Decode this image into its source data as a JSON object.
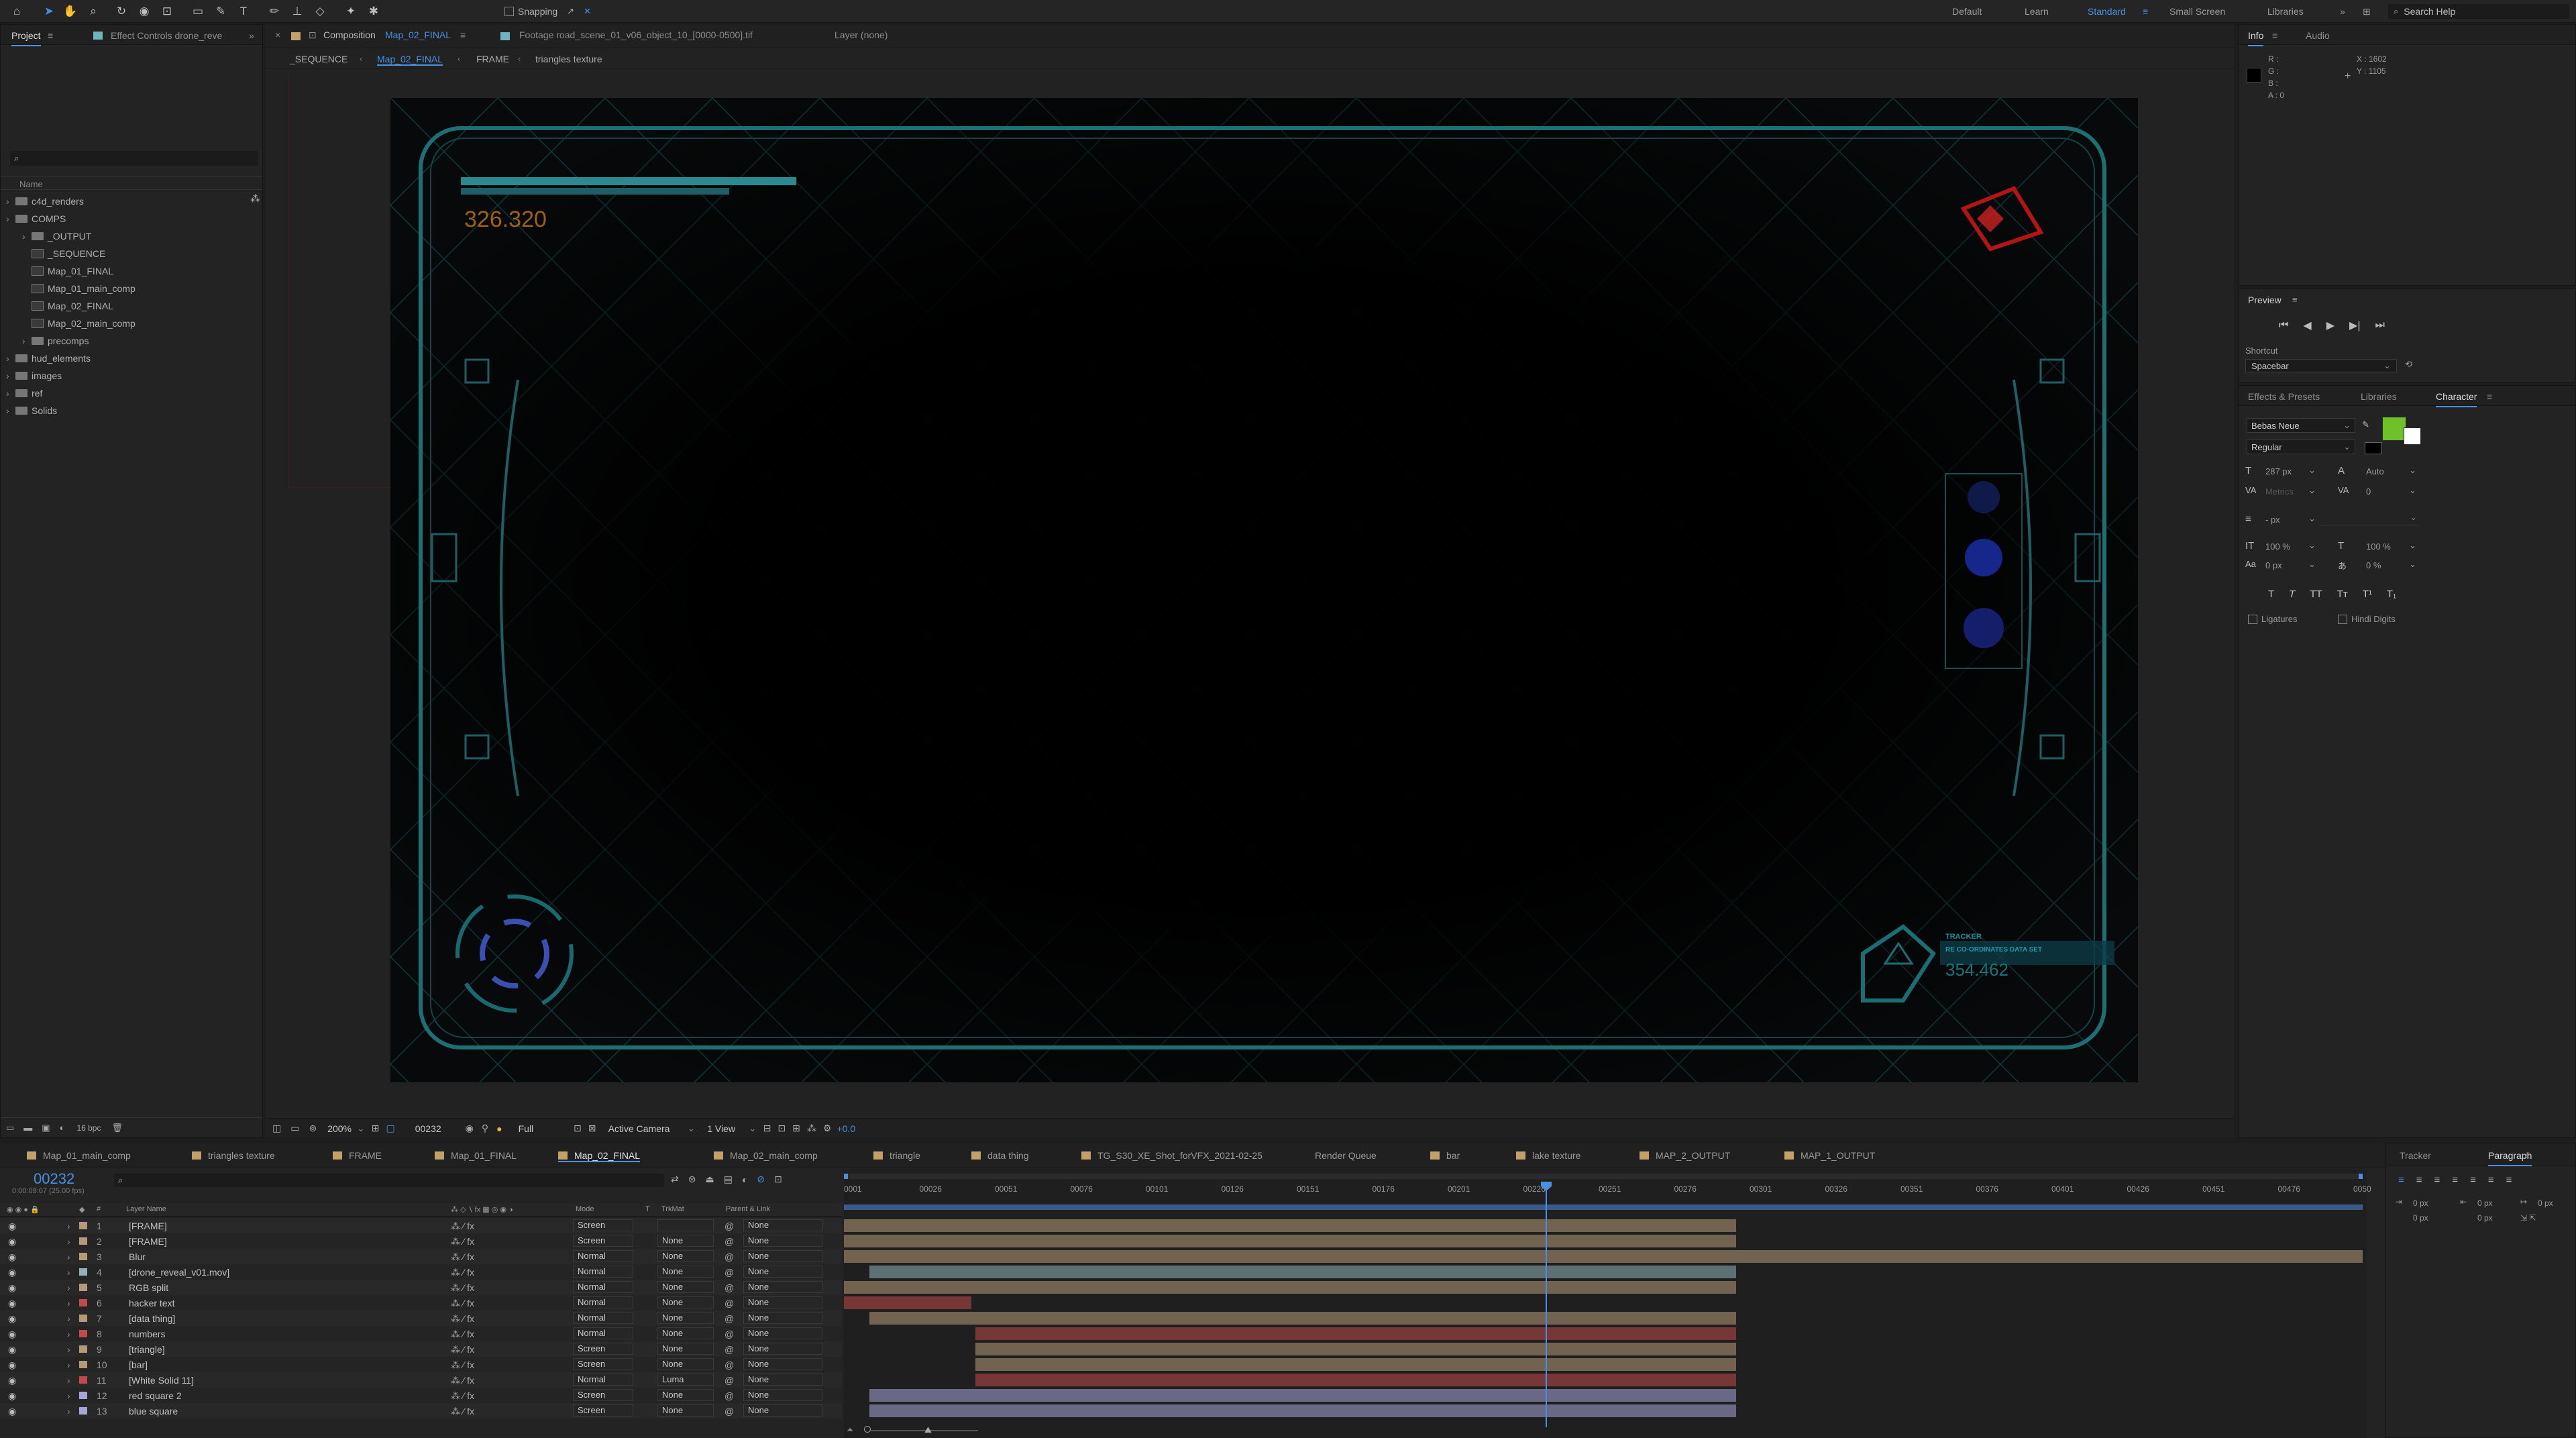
{
  "toolbar": {
    "snapping_label": "Snapping",
    "workspaces": [
      "Default",
      "Learn",
      "Standard",
      "Small Screen",
      "Libraries"
    ],
    "search_placeholder": "Search Help"
  },
  "project_panel": {
    "tabs": [
      "Project",
      "Effect Controls drone_reve"
    ],
    "column_name": "Name",
    "depth_label": "16 bpc",
    "items": [
      {
        "label": "c4d_renders",
        "type": "folder",
        "indent": 0
      },
      {
        "label": "COMPS",
        "type": "folder",
        "indent": 0
      },
      {
        "label": "_OUTPUT",
        "type": "folder",
        "indent": 1
      },
      {
        "label": "_SEQUENCE",
        "type": "comp",
        "indent": 1
      },
      {
        "label": "Map_01_FINAL",
        "type": "comp",
        "indent": 1
      },
      {
        "label": "Map_01_main_comp",
        "type": "comp",
        "indent": 1
      },
      {
        "label": "Map_02_FINAL",
        "type": "comp",
        "indent": 1
      },
      {
        "label": "Map_02_main_comp",
        "type": "comp",
        "indent": 1
      },
      {
        "label": "precomps",
        "type": "folder",
        "indent": 1
      },
      {
        "label": "hud_elements",
        "type": "folder",
        "indent": 0
      },
      {
        "label": "images",
        "type": "folder",
        "indent": 0
      },
      {
        "label": "ref",
        "type": "folder",
        "indent": 0
      },
      {
        "label": "Solids",
        "type": "folder",
        "indent": 0
      }
    ]
  },
  "viewer": {
    "tabs": [
      "Composition",
      "Map_02_FINAL",
      "Footage road_scene_01_v06_object_10_[0000-0500].tif",
      "Layer (none)"
    ],
    "breadcrumbs": [
      "_SEQUENCE",
      "Map_02_FINAL",
      "FRAME",
      "triangles texture"
    ],
    "hud_value_top": "326.320",
    "hud_value_bottom": "354.462",
    "hud_tracker_label": "TRACKER",
    "hud_tracker_sub": "RE CO-ORDINATES DATA SET",
    "controls": {
      "zoom": "200%",
      "timecode": "00232",
      "resolution": "Full",
      "camera": "Active Camera",
      "views": "1 View",
      "exposure": "+0.0"
    }
  },
  "info_panel": {
    "tabs": [
      "Info",
      "Audio"
    ],
    "r": "R :",
    "g": "G :",
    "b": "B :",
    "a": "A : 0",
    "x": "X : 1602",
    "y": "Y : 1105"
  },
  "preview_panel": {
    "title": "Preview",
    "shortcut_label": "Shortcut",
    "shortcut_value": "Spacebar"
  },
  "character_panel": {
    "tabs": [
      "Effects & Presets",
      "Libraries",
      "Character"
    ],
    "font": "Bebas Neue",
    "style": "Regular",
    "size": "287 px",
    "leading": "Auto",
    "kerning": "Metrics",
    "tracking": "0",
    "stroke_unit": "- px",
    "vscale": "100 %",
    "hscale": "100 %",
    "baseline": "0 px",
    "tsume": "0 %",
    "styles": [
      "T",
      "T",
      "TT",
      "Tт",
      "T¹",
      "T₁"
    ],
    "ligatures": "Ligatures",
    "hindi_digits": "Hindi Digits",
    "fill_color": "#6fc129"
  },
  "paragraph_panel": {
    "tabs": [
      "Tracker",
      "Paragraph"
    ],
    "indent_values": [
      "0 px",
      "0 px",
      "0 px",
      "0 px",
      "0 px"
    ]
  },
  "timeline": {
    "tabs": [
      {
        "label": "Map_01_main_comp",
        "color": "#c4a066"
      },
      {
        "label": "triangles texture",
        "color": "#c4a066"
      },
      {
        "label": "FRAME",
        "color": "#c4a066"
      },
      {
        "label": "Map_01_FINAL",
        "color": "#c4a066"
      },
      {
        "label": "Map_02_FINAL",
        "color": "#c4a066"
      },
      {
        "label": "Map_02_main_comp",
        "color": "#c4a066"
      },
      {
        "label": "triangle",
        "color": "#c4a066"
      },
      {
        "label": "data thing",
        "color": "#c4a066"
      },
      {
        "label": "TG_S30_XE_Shot_forVFX_2021-02-25",
        "color": "#c4a066"
      },
      {
        "label": "Render Queue",
        "color": ""
      },
      {
        "label": "bar",
        "color": "#c4a066"
      },
      {
        "label": "lake texture",
        "color": "#c4a066"
      },
      {
        "label": "MAP_2_OUTPUT",
        "color": "#c4a066"
      },
      {
        "label": "MAP_1_OUTPUT",
        "color": "#c4a066"
      }
    ],
    "current_time": "00232",
    "current_time_sub": "0:00:09:07 (25.00 fps)",
    "headers": {
      "layer_name": "Layer Name",
      "mode": "Mode",
      "t": "T",
      "trkmat": "TrkMat",
      "parent": "Parent & Link"
    },
    "ruler": [
      "0001",
      "00026",
      "00051",
      "00076",
      "00101",
      "00126",
      "00151",
      "00176",
      "00201",
      "00226",
      "00251",
      "00276",
      "00301",
      "00326",
      "00351",
      "00376",
      "00401",
      "00426",
      "00451",
      "00476",
      "0050"
    ],
    "layers": [
      {
        "num": "1",
        "name": "[FRAME]",
        "color": "#b59a77",
        "mode": "Screen",
        "trkmat": "",
        "parent": "None"
      },
      {
        "num": "2",
        "name": "[FRAME]",
        "color": "#b59a77",
        "mode": "Screen",
        "trkmat": "None",
        "parent": "None"
      },
      {
        "num": "3",
        "name": "Blur",
        "color": "#b59a77",
        "mode": "Normal",
        "trkmat": "None",
        "parent": "None"
      },
      {
        "num": "4",
        "name": "[drone_reveal_v01.mov]",
        "color": "#8fb3b8",
        "mode": "Normal",
        "trkmat": "None",
        "parent": "None"
      },
      {
        "num": "5",
        "name": "RGB split",
        "color": "#b59a77",
        "mode": "Normal",
        "trkmat": "None",
        "parent": "None"
      },
      {
        "num": "6",
        "name": "hacker text",
        "color": "#c14a4a",
        "mode": "Normal",
        "trkmat": "None",
        "parent": "None"
      },
      {
        "num": "7",
        "name": "[data thing]",
        "color": "#b59a77",
        "mode": "Normal",
        "trkmat": "None",
        "parent": "None"
      },
      {
        "num": "8",
        "name": "numbers",
        "color": "#c14a4a",
        "mode": "Normal",
        "trkmat": "None",
        "parent": "None"
      },
      {
        "num": "9",
        "name": "[triangle]",
        "color": "#b59a77",
        "mode": "Screen",
        "trkmat": "None",
        "parent": "None"
      },
      {
        "num": "10",
        "name": "[bar]",
        "color": "#b59a77",
        "mode": "Screen",
        "trkmat": "None",
        "parent": "None"
      },
      {
        "num": "11",
        "name": "[White Solid 11]",
        "color": "#c14a4a",
        "mode": "Normal",
        "trkmat": "Luma",
        "parent": "None"
      },
      {
        "num": "12",
        "name": "red square 2",
        "color": "#a8a6d8",
        "mode": "Screen",
        "trkmat": "None",
        "parent": "None"
      },
      {
        "num": "13",
        "name": "blue square",
        "color": "#a8a6d8",
        "mode": "Screen",
        "trkmat": "None",
        "parent": "None"
      }
    ]
  }
}
